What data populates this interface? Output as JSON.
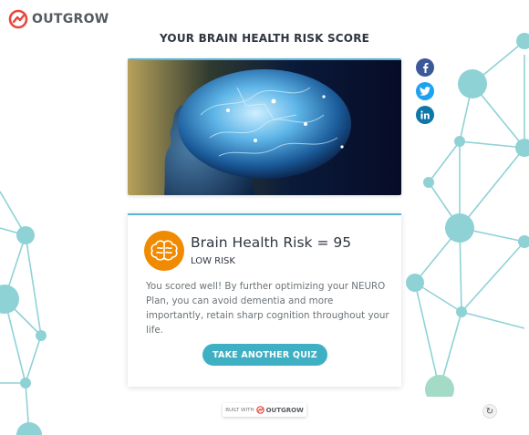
{
  "brand": {
    "name": "OUTGROW",
    "color": "#e8453c"
  },
  "page_title": "YOUR BRAIN HEALTH RISK SCORE",
  "share": [
    {
      "network": "facebook",
      "icon": "facebook-icon",
      "color": "#3b5998"
    },
    {
      "network": "twitter",
      "icon": "twitter-icon",
      "color": "#1da1f2"
    },
    {
      "network": "linkedin",
      "icon": "linkedin-icon",
      "color": "#0e76a8"
    }
  ],
  "result": {
    "icon": "brain-icon",
    "title": "Brain Health Risk = 95",
    "subtitle": "LOW RISK",
    "description": "You scored well! By further optimizing your NEURO Plan, you can avoid dementia and more importantly, retain sharp cognition throughout your life.",
    "cta_label": "TAKE ANOTHER QUIZ"
  },
  "footer": {
    "built_with": "BUILT WITH",
    "brand": "OUTGROW"
  },
  "colors": {
    "accent": "#3fb0c4",
    "icon_bg": "#f08a00",
    "network": "#7ccfd4"
  }
}
